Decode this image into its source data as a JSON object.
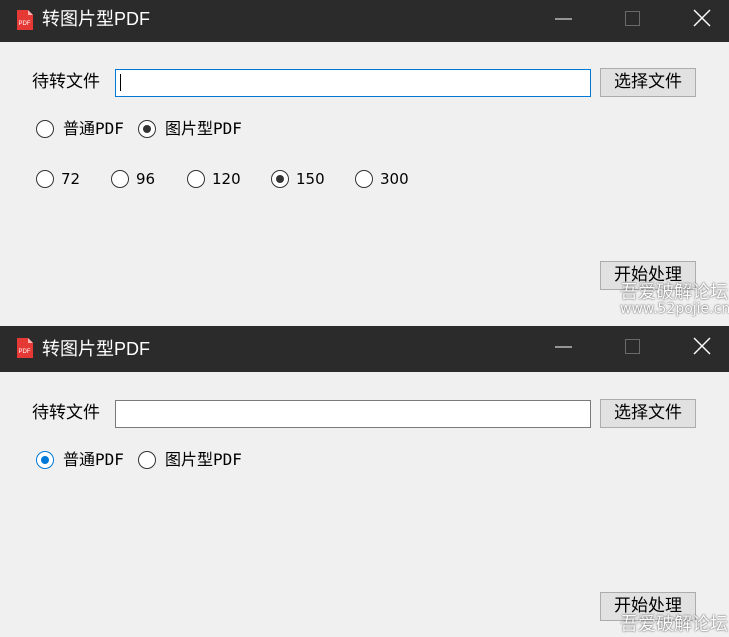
{
  "app": {
    "title": "转图片型PDF",
    "icon_label": "PDF",
    "accent_color": "#e53935"
  },
  "win1": {
    "file_label": "待转文件",
    "file_value": "",
    "choose_button": "选择文件",
    "modes": [
      {
        "label": "普通PDF",
        "selected": false
      },
      {
        "label": "图片型PDF",
        "selected": true
      }
    ],
    "dpi_options": [
      {
        "label": "72",
        "selected": false
      },
      {
        "label": "96",
        "selected": false
      },
      {
        "label": "120",
        "selected": false
      },
      {
        "label": "150",
        "selected": true
      },
      {
        "label": "300",
        "selected": false
      }
    ],
    "start_button": "开始处理"
  },
  "win2": {
    "file_label": "待转文件",
    "file_value": "",
    "choose_button": "选择文件",
    "modes": [
      {
        "label": "普通PDF",
        "selected": true
      },
      {
        "label": "图片型PDF",
        "selected": false
      }
    ],
    "start_button": "开始处理"
  },
  "watermark": {
    "main": "吾爱破解论坛",
    "sub": "www.52pojie.cn"
  }
}
